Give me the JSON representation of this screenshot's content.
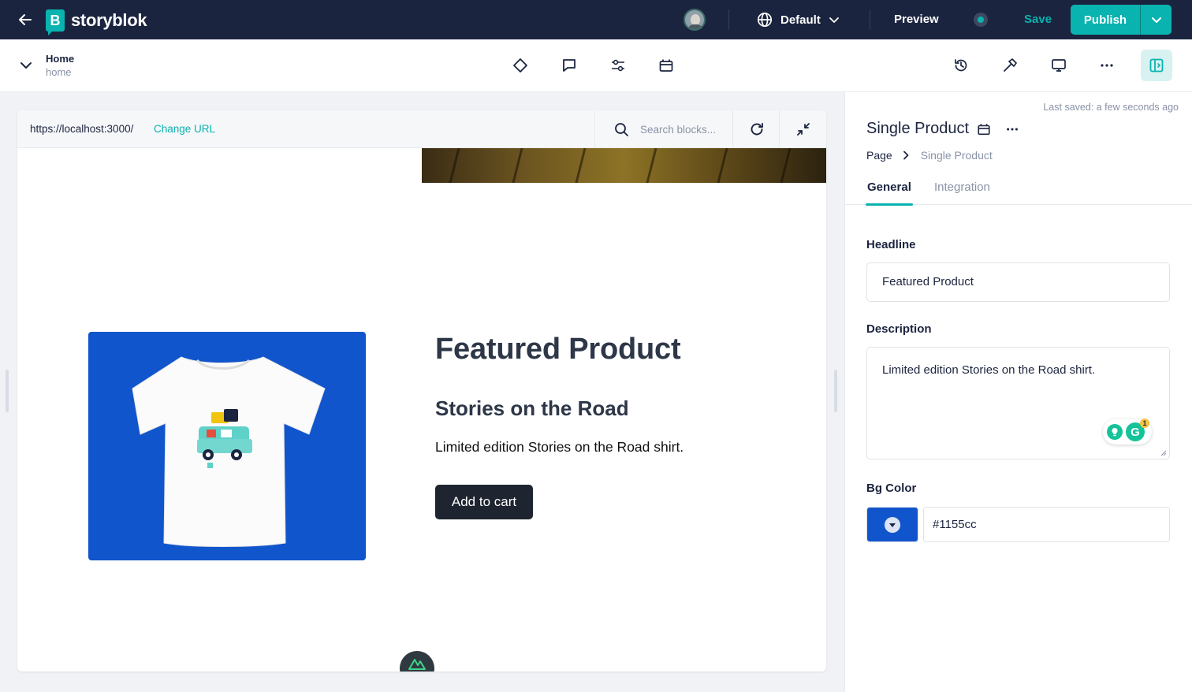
{
  "app": {
    "name": "storyblok",
    "logo_letter": "B",
    "brand_color": "#09b3af",
    "navy": "#1b243f"
  },
  "topbar": {
    "language": "Default",
    "preview_label": "Preview",
    "save_label": "Save",
    "publish_label": "Publish"
  },
  "story": {
    "title": "Home",
    "slug": "home"
  },
  "preview": {
    "url": "https://localhost:3000/",
    "change_url_label": "Change URL",
    "search_placeholder": "Search blocks..."
  },
  "product": {
    "headline": "Featured Product",
    "name": "Stories on the Road",
    "description": "Limited edition Stories on the Road shirt.",
    "cta": "Add to cart",
    "bg_color": "#1155cc"
  },
  "panel": {
    "last_saved": "Last saved: a few seconds ago",
    "component": "Single Product",
    "breadcrumb": {
      "parent": "Page",
      "current": "Single Product"
    },
    "tabs": {
      "general": "General",
      "integration": "Integration"
    },
    "fields": {
      "headline_label": "Headline",
      "headline_value": "Featured Product",
      "description_label": "Description",
      "description_value": "Limited edition Stories on the Road shirt.",
      "bg_color_label": "Bg Color",
      "bg_color_value": "#1155cc"
    },
    "grammarly": {
      "logo": "G",
      "count": "1"
    }
  }
}
